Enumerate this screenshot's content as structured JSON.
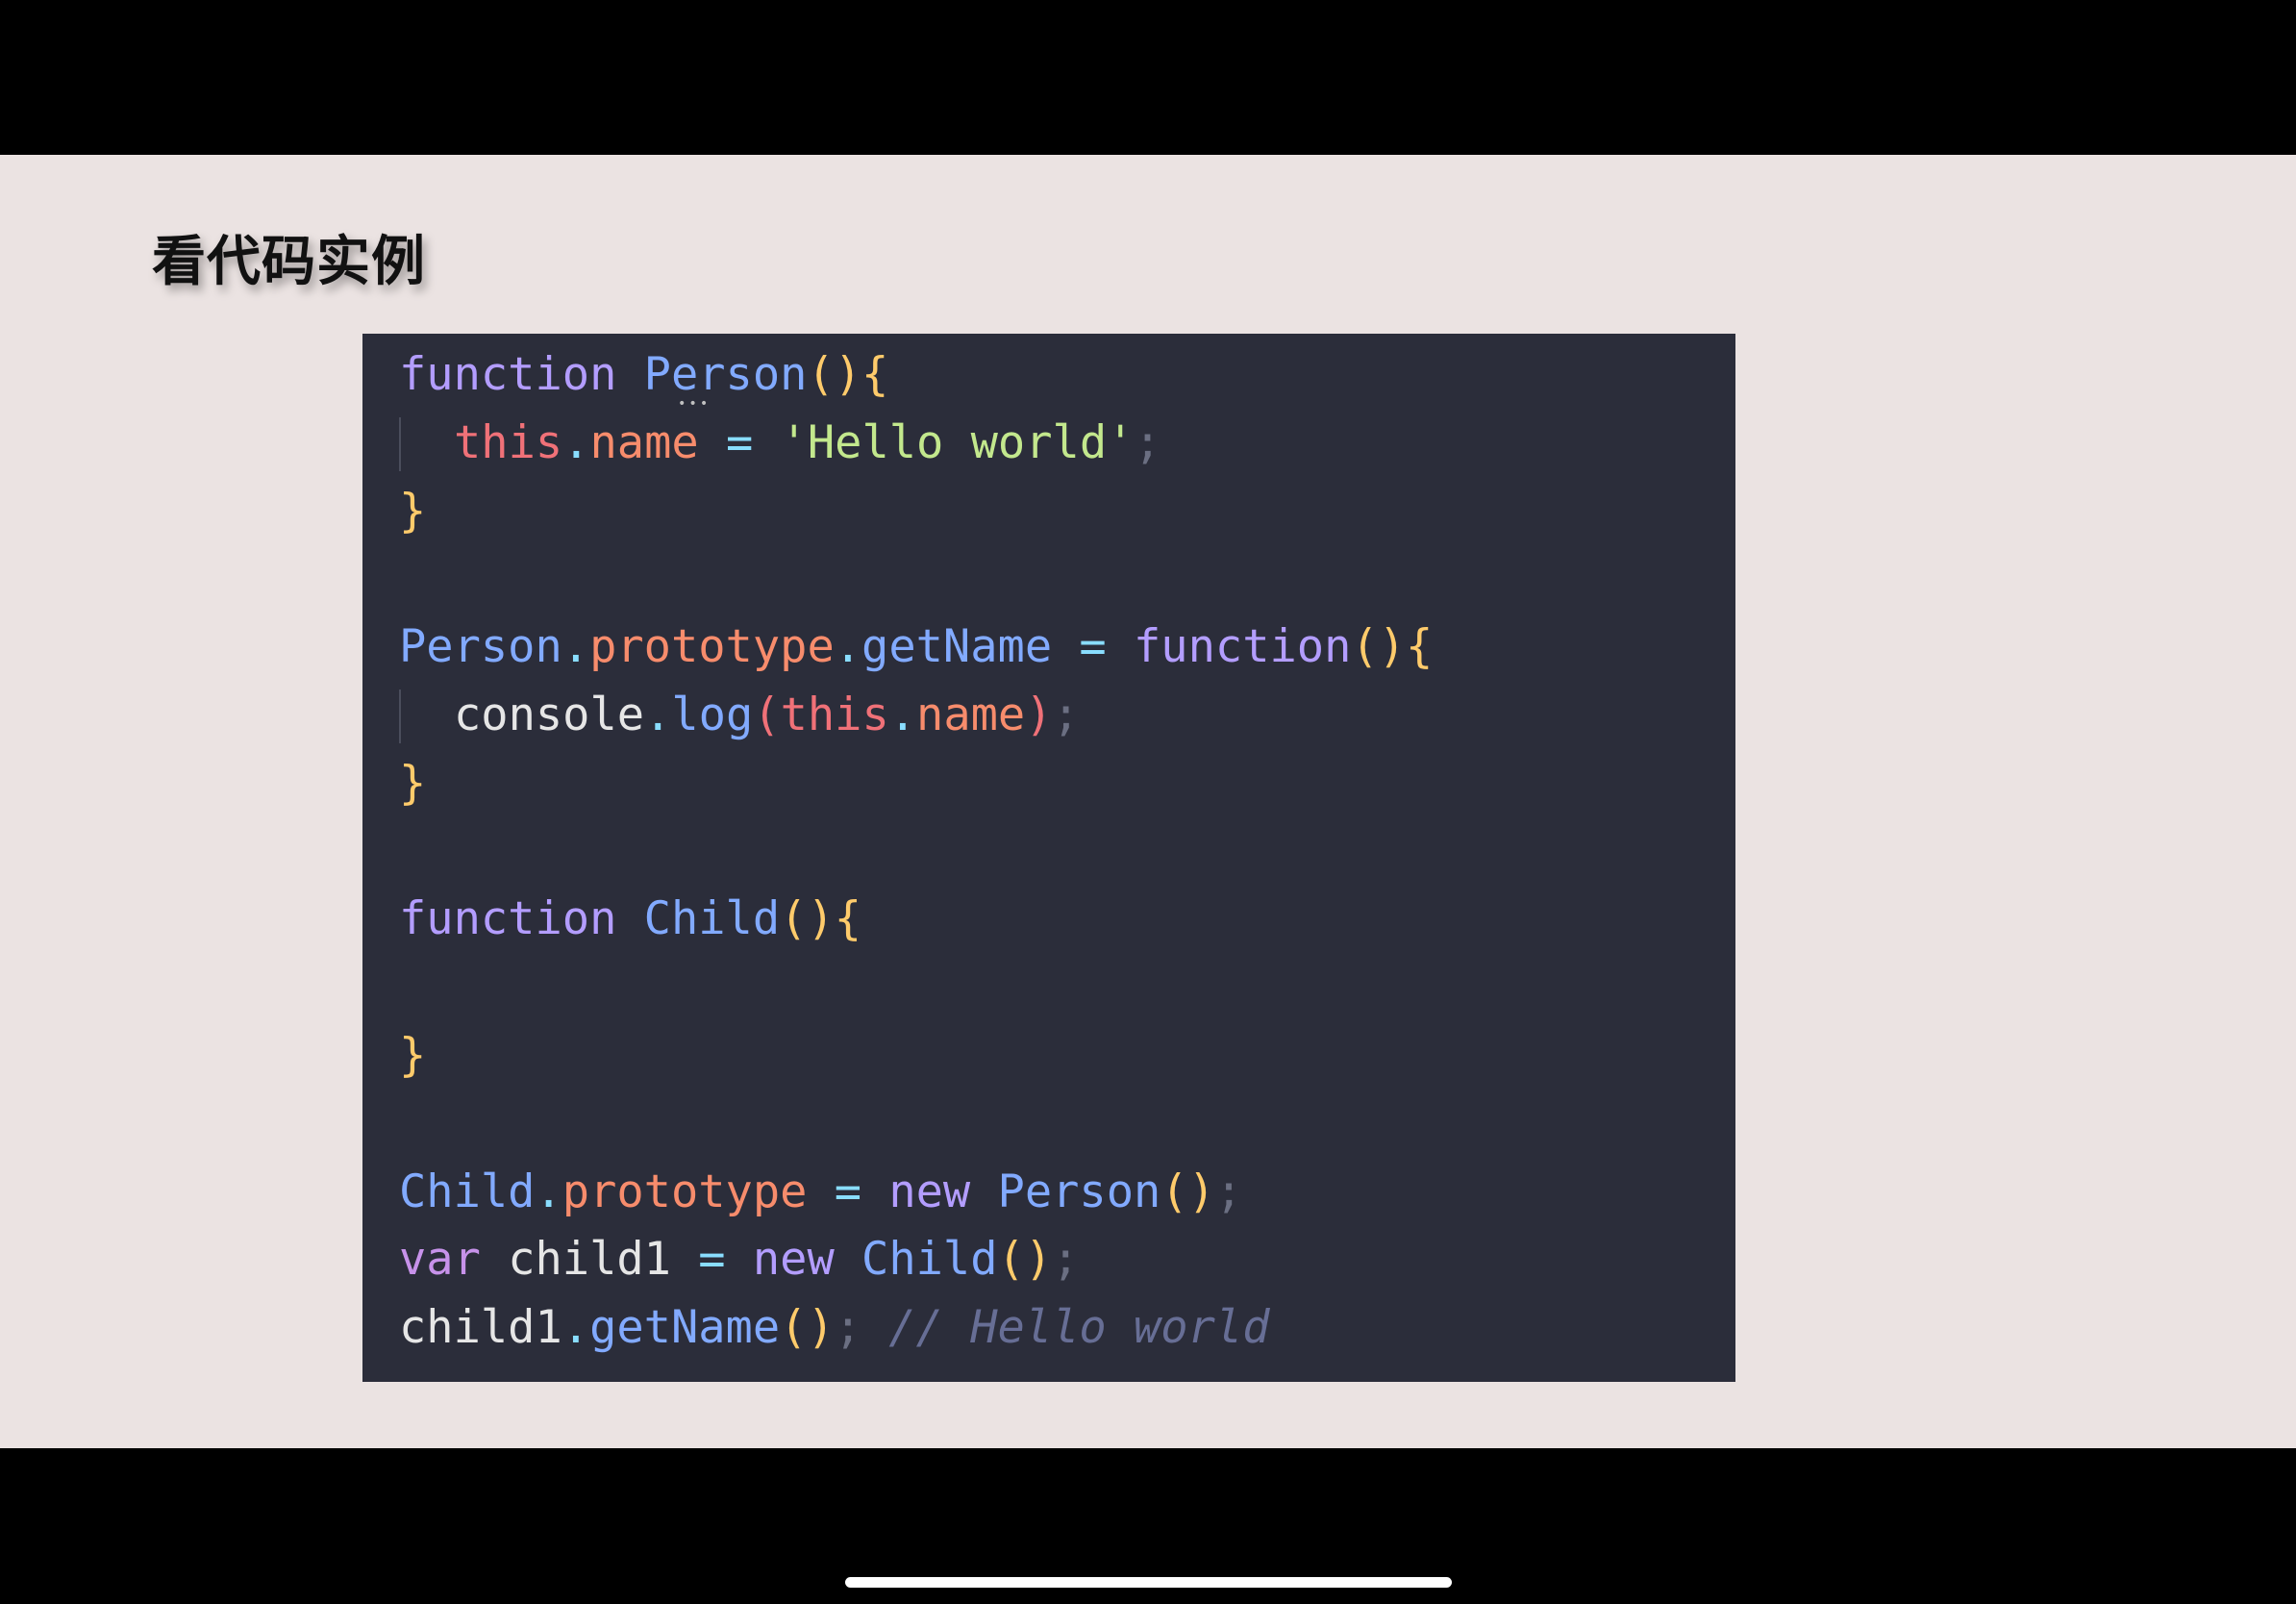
{
  "slide": {
    "title": "看代码实例"
  },
  "code": {
    "line1": {
      "kw": "function",
      "name": "Person",
      "parens": "()",
      "brace": "{"
    },
    "line2": {
      "this": "this",
      "dot": ".",
      "prop": "name",
      "op": " = ",
      "str": "'Hello world'",
      "semi": ";"
    },
    "line3": {
      "brace": "}"
    },
    "line5": {
      "cls": "Person",
      "dot1": ".",
      "proto": "prototype",
      "dot2": ".",
      "method": "getName",
      "op": " = ",
      "kw": "function",
      "parens": "()",
      "brace": "{"
    },
    "line6": {
      "obj": "console",
      "dot": ".",
      "method": "log",
      "open": "(",
      "this": "this",
      "dot2": ".",
      "prop": "name",
      "close": ")",
      "semi": ";"
    },
    "line7": {
      "brace": "}"
    },
    "line9": {
      "kw": "function",
      "name": "Child",
      "parens": "()",
      "brace": "{"
    },
    "line11": {
      "brace": "}"
    },
    "line13": {
      "cls": "Child",
      "dot": ".",
      "proto": "prototype",
      "op": " = ",
      "kw": "new",
      "name": "Person",
      "parens": "()",
      "semi": ";"
    },
    "line14": {
      "kw": "var",
      "ident": "child1",
      "op": " = ",
      "kw2": "new",
      "name": "Child",
      "parens": "()",
      "semi": ";"
    },
    "line15": {
      "ident": "child1",
      "dot": ".",
      "method": "getName",
      "parens": "()",
      "semi": ";",
      "comment": "// Hello world"
    }
  }
}
